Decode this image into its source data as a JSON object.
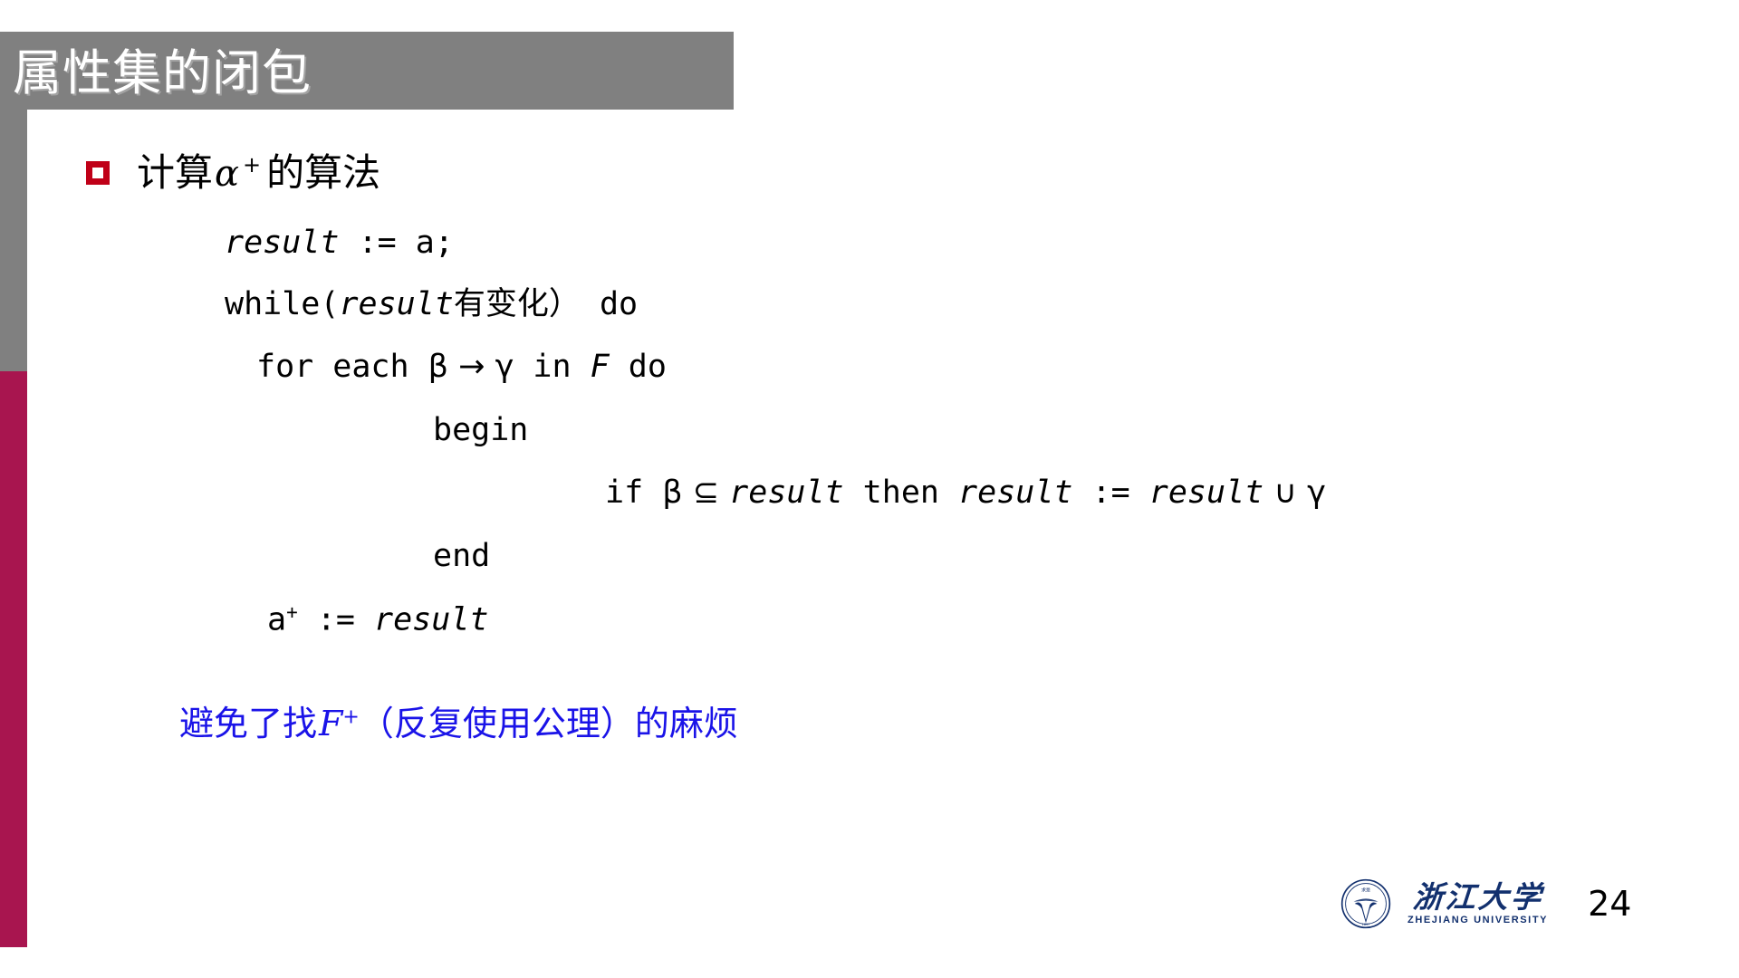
{
  "slide": {
    "title": "属性集的闭包",
    "page_number": "24"
  },
  "theme": {
    "title_band_color": "#808080",
    "rail_gray": "#808080",
    "rail_crimson": "#a8154f",
    "bullet_color": "#c00018",
    "remark_color": "#1a13e8",
    "logo_color": "#12306e",
    "background": "#ffffff"
  },
  "bullet": {
    "prefix": "计算",
    "greek": "α",
    "superscript": "+",
    "suffix": "的算法",
    "full_text": "计算α + 的算法"
  },
  "code": {
    "result_line": {
      "var": "result",
      "rest": " := a;",
      "full": "result := a;"
    },
    "while_line": {
      "keyword": "while(",
      "var": "result",
      "cjk": "有变化）",
      "rest": " do",
      "full": "while(result有变化） do"
    },
    "foreach_line": {
      "prefix": "for each ",
      "beta": "β",
      "arrow": "→",
      "gamma": "γ",
      "mid": " in ",
      "f": "F",
      "suffix": " do",
      "full": "for each β → γ in F do"
    },
    "begin_line": "begin",
    "if_line": {
      "keyword": "if ",
      "beta": "β",
      "subset": "⊆",
      "var1": "result",
      "then": " then ",
      "var2": "result",
      "assign": " := ",
      "var3": "result",
      "union": "∪",
      "gamma": "γ",
      "full": "if β ⊆ result then result := result ∪ γ"
    },
    "end_line": "end",
    "aplus_line": {
      "base": "a",
      "superscript": "+",
      "assign": " := ",
      "var": "result",
      "full": "a+ := result"
    }
  },
  "remark": {
    "prefix": "避免了找",
    "f": "F",
    "superscript": "+",
    "suffix": "（反复使用公理）的麻烦",
    "full": "避免了找F+（反复使用公理）的麻烦"
  },
  "footer": {
    "logo_cn": "浙江大学",
    "logo_en": "ZHEJIANG UNIVERSITY",
    "page_number": "24"
  }
}
